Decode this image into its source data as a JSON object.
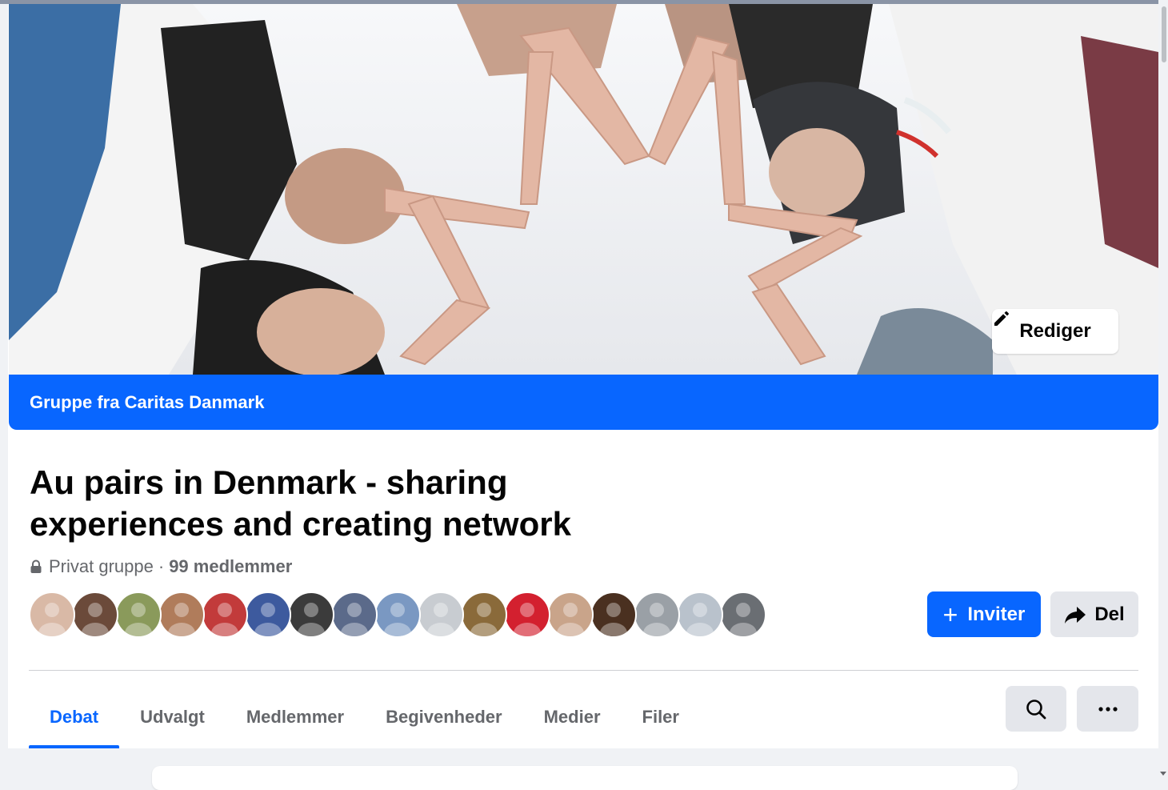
{
  "cover": {
    "edit_label": "Rediger"
  },
  "group_bar": {
    "text": "Gruppe fra Caritas Danmark"
  },
  "group": {
    "title_line1": "Au pairs in Denmark - sharing",
    "title_line2": "experiences and creating network",
    "privacy": "Privat gruppe",
    "separator": "·",
    "members": "99 medlemmer"
  },
  "actions": {
    "invite_label": "Inviter",
    "share_label": "Del"
  },
  "tabs": [
    {
      "label": "Debat",
      "active": true
    },
    {
      "label": "Udvalgt",
      "active": false
    },
    {
      "label": "Medlemmer",
      "active": false
    },
    {
      "label": "Begivenheder",
      "active": false
    },
    {
      "label": "Medier",
      "active": false
    },
    {
      "label": "Filer",
      "active": false
    }
  ],
  "avatars": [
    {
      "color": "#d9b9a6"
    },
    {
      "color": "#6b4a3a"
    },
    {
      "color": "#8a9a5b"
    },
    {
      "color": "#b07c5b"
    },
    {
      "color": "#c23b3b"
    },
    {
      "color": "#3d5a9e"
    },
    {
      "color": "#3b3b3b"
    },
    {
      "color": "#5b6a8a"
    },
    {
      "color": "#7a98c2"
    },
    {
      "color": "#c8ccd1"
    },
    {
      "color": "#8a6a3a"
    },
    {
      "color": "#d3202f"
    },
    {
      "color": "#c9a48a"
    },
    {
      "color": "#4a3020"
    },
    {
      "color": "#9aa0a6"
    },
    {
      "color": "#b9c2cc"
    },
    {
      "color": "#6a6e73"
    }
  ],
  "colors": {
    "brand": "#0866ff",
    "secondary_button": "#e4e6eb",
    "muted_text": "#65676b"
  },
  "icons": [
    "pencil-icon",
    "lock-icon",
    "plus-icon",
    "share-arrow-icon",
    "search-icon",
    "more-dots-icon"
  ]
}
